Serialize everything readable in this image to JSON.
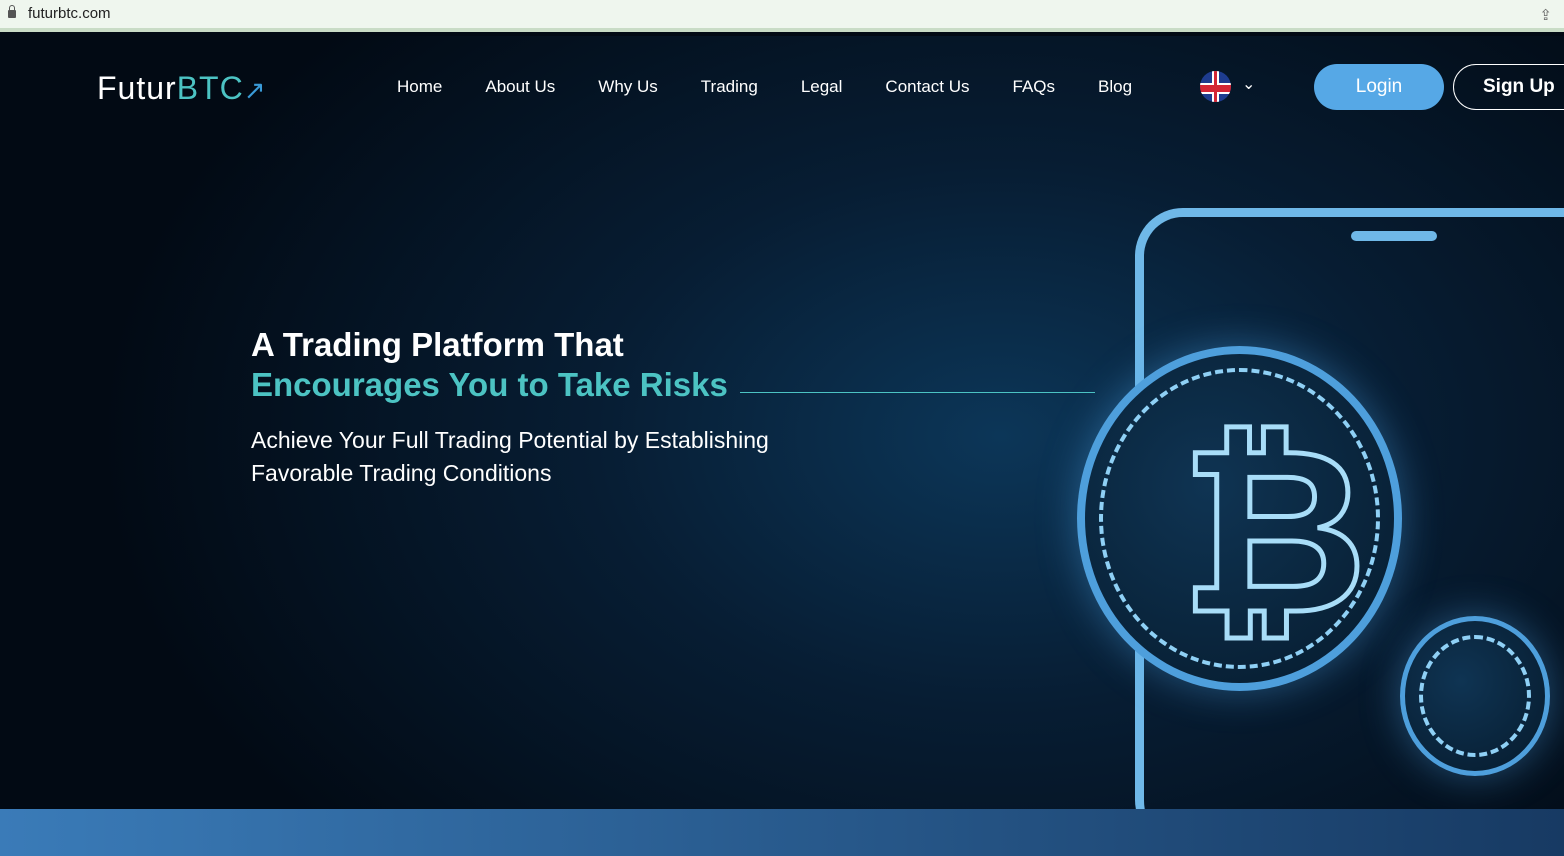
{
  "browser": {
    "url": "futurbtc.com"
  },
  "header": {
    "logo_main": "Futur",
    "logo_accent": "BTC",
    "nav": [
      "Home",
      "About Us",
      "Why Us",
      "Trading",
      "Legal",
      "Contact Us",
      "FAQs",
      "Blog"
    ],
    "login": "Login",
    "signup": "Sign Up"
  },
  "hero": {
    "title_line1": "A Trading Platform That",
    "title_line2": "Encourages You to Take Risks",
    "subtitle": "Achieve Your Full Trading Potential by Establishing Favorable Trading Conditions",
    "btc_symbol": "₿"
  },
  "colors": {
    "accent": "#4cc3c3",
    "button": "#56a8e6"
  }
}
